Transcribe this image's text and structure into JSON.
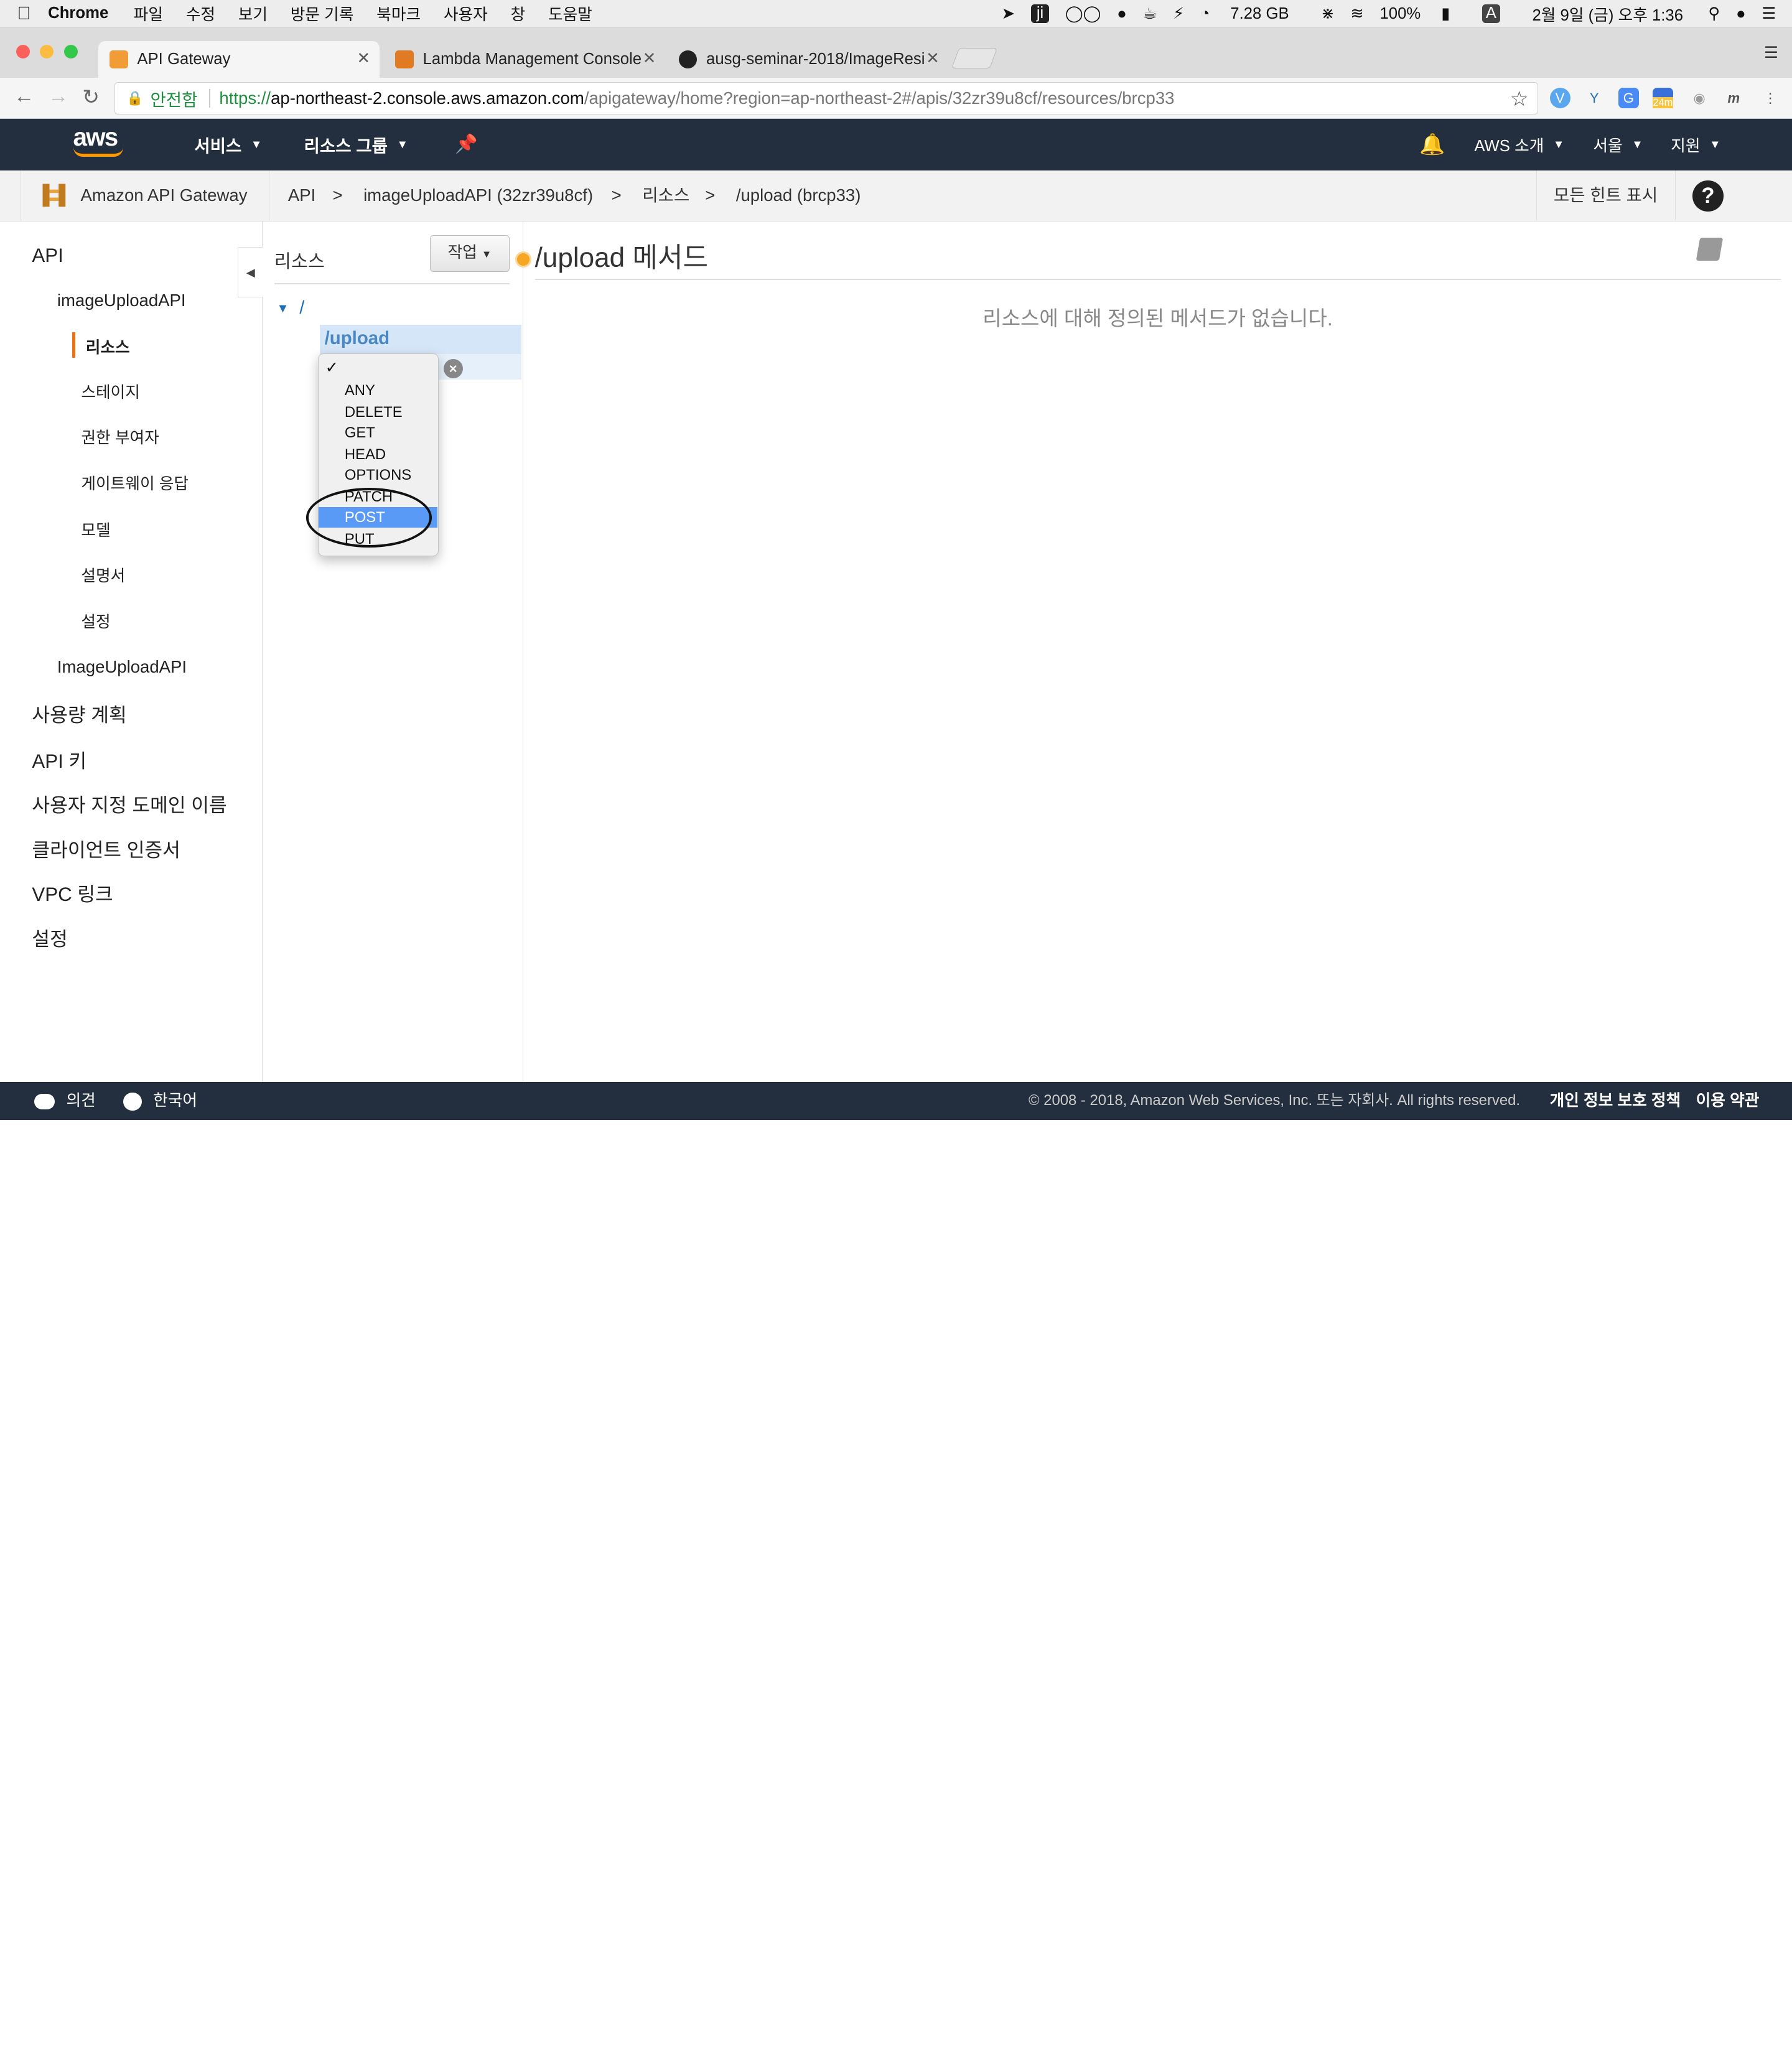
{
  "menubar": {
    "app": "Chrome",
    "menus": [
      "파일",
      "수정",
      "보기",
      "방문 기록",
      "북마크",
      "사용자",
      "창",
      "도움말"
    ],
    "memory": "7.28 GB",
    "battery": "100%",
    "input_method": "A",
    "clock": "2월 9일 (금) 오후 1:36"
  },
  "tabs": [
    {
      "title": "API Gateway"
    },
    {
      "title": "Lambda Management Console"
    },
    {
      "title": "ausg-seminar-2018/ImageResi"
    }
  ],
  "address": {
    "secure_label": "안전함",
    "scheme": "https://",
    "host": "ap-northeast-2.console.aws.amazon.com",
    "path": "/apigateway/home?region=ap-northeast-2#/apis/32zr39u8cf/resources/brcp33"
  },
  "extensions": {
    "badge": "24m"
  },
  "aws_nav": {
    "logo": "aws",
    "services": "서비스",
    "resource_groups": "리소스 그룹",
    "account": "AWS 소개",
    "region": "서울",
    "support": "지원"
  },
  "breadcrumb": {
    "service": "Amazon API Gateway",
    "items": [
      "API",
      "imageUploadAPI (32zr39u8cf)",
      "리소스",
      "/upload (brcp33)"
    ],
    "separator": ">",
    "hints": "모든 힌트 표시",
    "help": "?"
  },
  "left_nav": {
    "api": "API",
    "api_name": "imageUploadAPI",
    "sub_items": [
      "리소스",
      "스테이지",
      "권한 부여자",
      "게이트웨이 응답",
      "모델",
      "설명서",
      "설정"
    ],
    "api_name2": "ImageUploadAPI",
    "sections": [
      "사용량 계획",
      "API 키",
      "사용자 지정 도메인 이름",
      "클라이언트 인증서",
      "VPC 링크",
      "설정"
    ]
  },
  "resources": {
    "title": "리소스",
    "action_button": "작업",
    "root": "/",
    "selected": "/upload"
  },
  "method_dropdown": {
    "options": [
      "ANY",
      "DELETE",
      "GET",
      "HEAD",
      "OPTIONS",
      "PATCH",
      "POST",
      "PUT"
    ],
    "highlighted": "POST"
  },
  "main": {
    "title": "/upload 메서드",
    "empty_message": "리소스에 대해 정의된 메서드가 없습니다."
  },
  "footer": {
    "feedback": "의견",
    "language": "한국어",
    "copyright": "© 2008 - 2018, Amazon Web Services, Inc. 또는 자회사. All rights reserved.",
    "privacy": "개인 정보 보호 정책",
    "terms": "이용 약관"
  },
  "colors": {
    "aws_nav_bg": "#232f3e",
    "aws_orange": "#ff9900",
    "highlight_blue": "#5a9af7",
    "selected_row": "#d5e6f8"
  }
}
